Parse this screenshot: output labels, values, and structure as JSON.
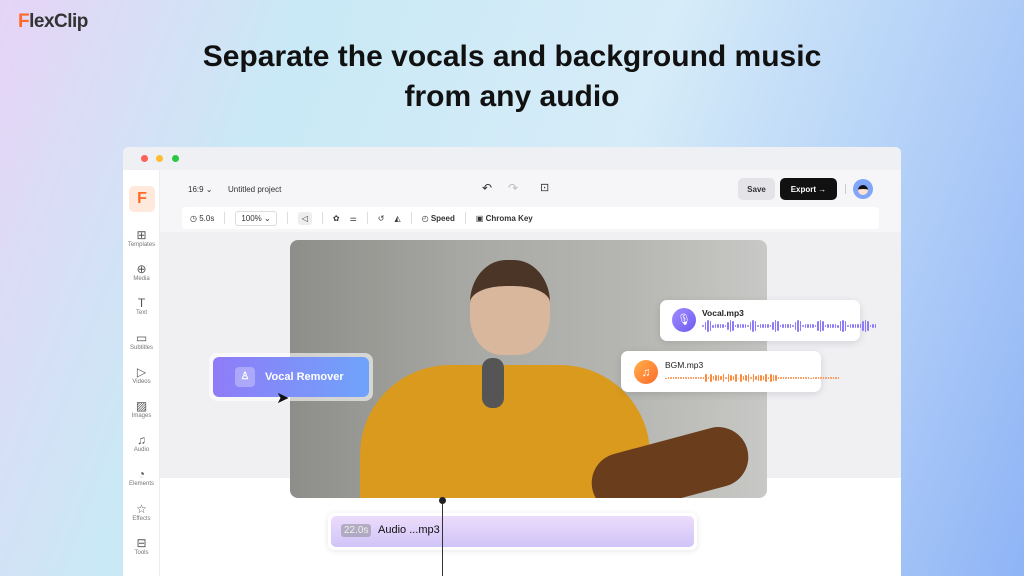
{
  "brand": {
    "logo": "FlexClip"
  },
  "headline": {
    "line1": "Separate the vocals and background music",
    "line2": "from any audio"
  },
  "sidebar": {
    "items": [
      {
        "label": "Templates",
        "icon": "templates-icon",
        "glyph": "⊞"
      },
      {
        "label": "Media",
        "icon": "media-folder-icon",
        "glyph": "⊕"
      },
      {
        "label": "Text",
        "icon": "text-icon",
        "glyph": "T"
      },
      {
        "label": "Subtitles",
        "icon": "subtitles-icon",
        "glyph": "▭"
      },
      {
        "label": "Videos",
        "icon": "video-icon",
        "glyph": "▷"
      },
      {
        "label": "Images",
        "icon": "image-icon",
        "glyph": "▨"
      },
      {
        "label": "Audio",
        "icon": "music-note-icon",
        "glyph": "♫"
      },
      {
        "label": "Elements",
        "icon": "elements-icon",
        "glyph": "◔"
      },
      {
        "label": "Effects",
        "icon": "effects-star-icon",
        "glyph": "☆"
      },
      {
        "label": "Tools",
        "icon": "toolbox-icon",
        "glyph": "⊟"
      }
    ]
  },
  "topbar": {
    "ratio": "16:9",
    "project": "Untitled project",
    "save": "Save",
    "export": "Export →"
  },
  "toolbar": {
    "duration": "5.0s",
    "zoom": "100%",
    "speed": "Speed",
    "chroma": "Chroma Key"
  },
  "vocal_remover": {
    "label": "Vocal Remover"
  },
  "tracks": [
    {
      "name": "Vocal.mp3",
      "color": "#7b6cf6"
    },
    {
      "name": "BGM.mp3",
      "color": "#ff8a3d"
    }
  ],
  "timeline": {
    "duration": "22.0s",
    "clip": "Audio ...mp3"
  },
  "colors": {
    "accent": "#ff6a2b",
    "vocal": "#8b7bf8",
    "bgm": "#ff8a3d",
    "remover": "#7e8af8"
  }
}
